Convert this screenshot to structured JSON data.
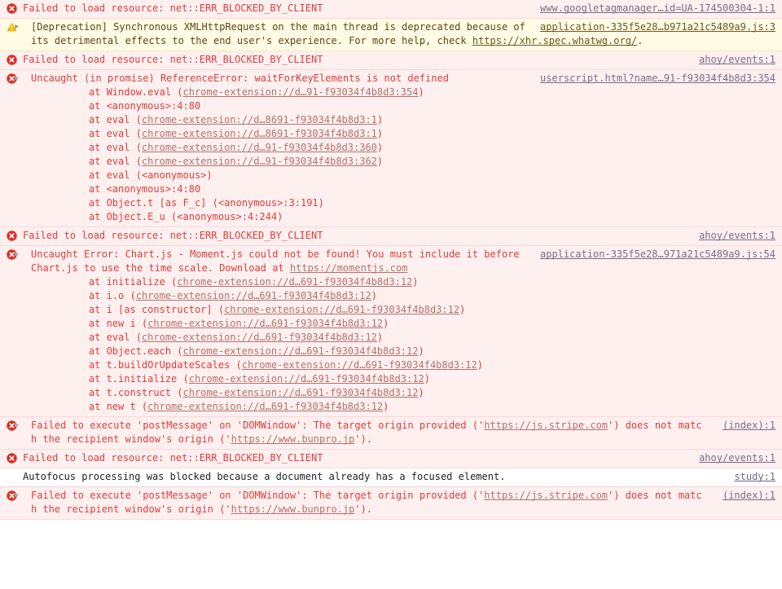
{
  "console": {
    "messages": [
      {
        "level": "error",
        "icon": "error-circle-icon",
        "expandable": false,
        "text": "Failed to load resource: net::ERR_BLOCKED_BY_CLIENT",
        "source": "www.googletagmanager…id=UA-174500304-1:1"
      },
      {
        "level": "warning",
        "icon": "warning-triangle-icon",
        "expandable": true,
        "text_part1": "[Deprecation] Synchronous XMLHttpRequest on the main thread is deprecated because of its detrimental effects to the end user's experience. For more help, check ",
        "link1": "https://xhr.spec.whatwg.org/",
        "text_part2": ".",
        "source": "application-335f5e28…b971a21c5489a9.js:3"
      },
      {
        "level": "error",
        "icon": "error-circle-icon",
        "expandable": false,
        "text": "Failed to load resource: net::ERR_BLOCKED_BY_CLIENT",
        "source": "ahoy/events:1"
      },
      {
        "level": "error",
        "icon": "error-circle-icon",
        "expandable": true,
        "text": "Uncaught (in promise) ReferenceError: waitForKeyElements is not defined",
        "source": "userscript.html?name…91-f93034f4b8d3:354",
        "stack": [
          {
            "prefix": "    at Window.eval (",
            "link": "chrome-extension://d…91-f93034f4b8d3:354",
            "suffix": ")"
          },
          {
            "prefix": "    at <anonymous>:4:80",
            "link": "",
            "suffix": ""
          },
          {
            "prefix": "    at eval (",
            "link": "chrome-extension://d…8691-f93034f4b8d3:1",
            "suffix": ")"
          },
          {
            "prefix": "    at eval (",
            "link": "chrome-extension://d…8691-f93034f4b8d3:1",
            "suffix": ")"
          },
          {
            "prefix": "    at eval (",
            "link": "chrome-extension://d…91-f93034f4b8d3:360",
            "suffix": ")"
          },
          {
            "prefix": "    at eval (",
            "link": "chrome-extension://d…91-f93034f4b8d3:362",
            "suffix": ")"
          },
          {
            "prefix": "    at eval (<anonymous>)",
            "link": "",
            "suffix": ""
          },
          {
            "prefix": "    at <anonymous>:4:80",
            "link": "",
            "suffix": ""
          },
          {
            "prefix": "    at Object.t [as F_c] (<anonymous>:3:191)",
            "link": "",
            "suffix": ""
          },
          {
            "prefix": "    at Object.E_u (<anonymous>:4:244)",
            "link": "",
            "suffix": ""
          }
        ]
      },
      {
        "level": "error",
        "icon": "error-circle-icon",
        "expandable": false,
        "text": "Failed to load resource: net::ERR_BLOCKED_BY_CLIENT",
        "source": "ahoy/events:1"
      },
      {
        "level": "error",
        "icon": "error-circle-icon",
        "expandable": true,
        "text_part1": "Uncaught Error: Chart.js - Moment.js could not be found! You must include it before Chart.js to use the time scale. Download at ",
        "link1": "https://momentjs.com",
        "text_part2": "",
        "source": "application-335f5e28…971a21c5489a9.js:54",
        "stack": [
          {
            "prefix": "    at initialize (",
            "link": "chrome-extension://d…691-f93034f4b8d3:12",
            "suffix": ")"
          },
          {
            "prefix": "    at i.o (",
            "link": "chrome-extension://d…691-f93034f4b8d3:12",
            "suffix": ")"
          },
          {
            "prefix": "    at i [as constructor] (",
            "link": "chrome-extension://d…691-f93034f4b8d3:12",
            "suffix": ")"
          },
          {
            "prefix": "    at new i (",
            "link": "chrome-extension://d…691-f93034f4b8d3:12",
            "suffix": ")"
          },
          {
            "prefix": "    at eval (",
            "link": "chrome-extension://d…691-f93034f4b8d3:12",
            "suffix": ")"
          },
          {
            "prefix": "    at Object.each (",
            "link": "chrome-extension://d…691-f93034f4b8d3:12",
            "suffix": ")"
          },
          {
            "prefix": "    at t.buildOrUpdateScales (",
            "link": "chrome-extension://d…691-f93034f4b8d3:12",
            "suffix": ")"
          },
          {
            "prefix": "    at t.initialize (",
            "link": "chrome-extension://d…691-f93034f4b8d3:12",
            "suffix": ")"
          },
          {
            "prefix": "    at t.construct (",
            "link": "chrome-extension://d…691-f93034f4b8d3:12",
            "suffix": ")"
          },
          {
            "prefix": "    at new t (",
            "link": "chrome-extension://d…691-f93034f4b8d3:12",
            "suffix": ")"
          }
        ]
      },
      {
        "level": "error",
        "icon": "error-circle-icon",
        "expandable": true,
        "text_part1": "Failed to execute 'postMessage' on 'DOMWindow': The target origin provided ('",
        "link1": "https://js.stripe.com",
        "text_part2": "') does not match the recipient window's origin ('",
        "link2": "https://www.bunpro.jp",
        "text_part3": "').",
        "source": "(index):1"
      },
      {
        "level": "error",
        "icon": "error-circle-icon",
        "expandable": false,
        "text": "Failed to load resource: net::ERR_BLOCKED_BY_CLIENT",
        "source": "ahoy/events:1"
      },
      {
        "level": "info",
        "icon": "",
        "expandable": false,
        "text": "Autofocus processing was blocked because a document already has a focused element.",
        "source": "study:1"
      },
      {
        "level": "error",
        "icon": "error-circle-icon",
        "expandable": true,
        "text_part1": "Failed to execute 'postMessage' on 'DOMWindow': The target origin provided ('",
        "link1": "https://js.stripe.com",
        "text_part2": "') does not match the recipient window's origin ('",
        "link2": "https://www.bunpro.jp",
        "text_part3": "').",
        "source": "(index):1"
      }
    ]
  },
  "colors": {
    "error_bg": "#fff0f0",
    "warning_bg": "#fffbe5",
    "info_bg": "#ffffff",
    "error_text": "#e03c3c",
    "warning_text": "#5c4813",
    "error_icon": "#d93025",
    "warning_icon": "#f0b400",
    "link": "#6c6c8a"
  }
}
